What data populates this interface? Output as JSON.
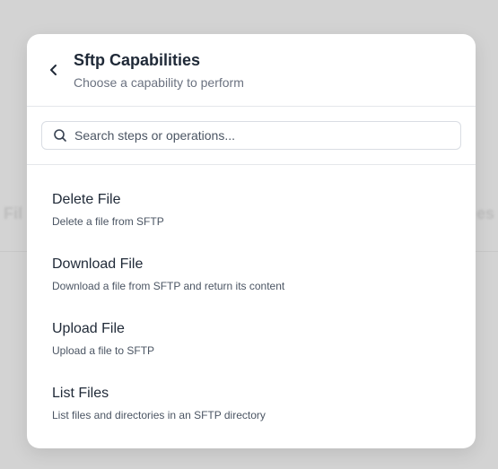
{
  "background": {
    "left_hint": "Fil",
    "right_hint": "es"
  },
  "modal": {
    "title": "Sftp Capabilities",
    "subtitle": "Choose a capability to perform",
    "back_icon": "chevron-left-icon"
  },
  "search": {
    "placeholder": "Search steps or operations...",
    "value": "",
    "icon": "search-icon"
  },
  "capabilities": [
    {
      "title": "Delete File",
      "description": "Delete a file from SFTP"
    },
    {
      "title": "Download File",
      "description": "Download a file from SFTP and return its content"
    },
    {
      "title": "Upload File",
      "description": "Upload a file to SFTP"
    },
    {
      "title": "List Files",
      "description": "List files and directories in an SFTP directory"
    }
  ],
  "colors": {
    "overlay": "#d3d3d3",
    "modal_bg": "#ffffff",
    "title": "#1f2937",
    "muted": "#6b7280",
    "border": "#e5e7eb"
  }
}
